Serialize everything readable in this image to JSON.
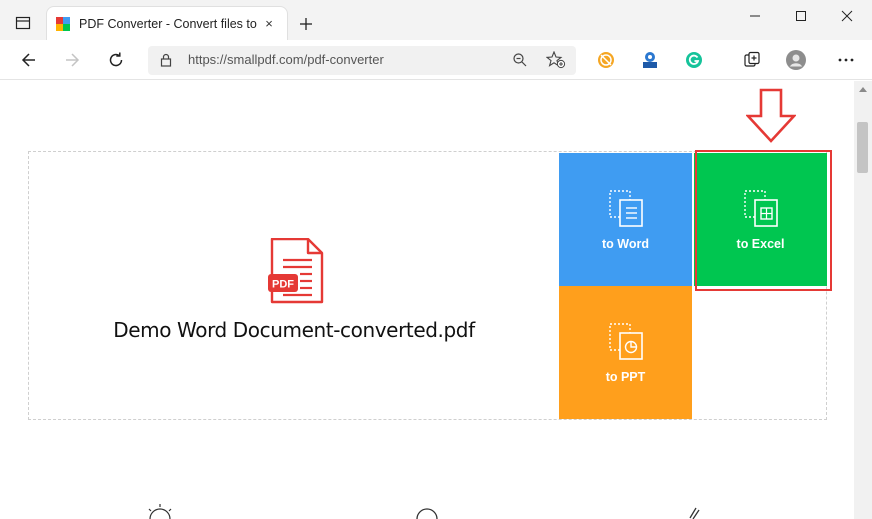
{
  "browser": {
    "tab": {
      "title": "PDF Converter - Convert files to",
      "close_glyph": "×"
    },
    "new_tab_glyph": "+",
    "url": "https://smallpdf.com/pdf-converter"
  },
  "converter": {
    "file_name": "Demo Word Document-converted.pdf",
    "doc_icon_label": "PDF",
    "options": [
      {
        "label": "to Word",
        "color": "#3f9cf2"
      },
      {
        "label": "to Excel",
        "color": "#00c650"
      },
      {
        "label": "to PPT",
        "color": "#ff9f1c"
      }
    ]
  },
  "annotation": {
    "color": "#e53935",
    "icon": "down-arrow-icon"
  }
}
